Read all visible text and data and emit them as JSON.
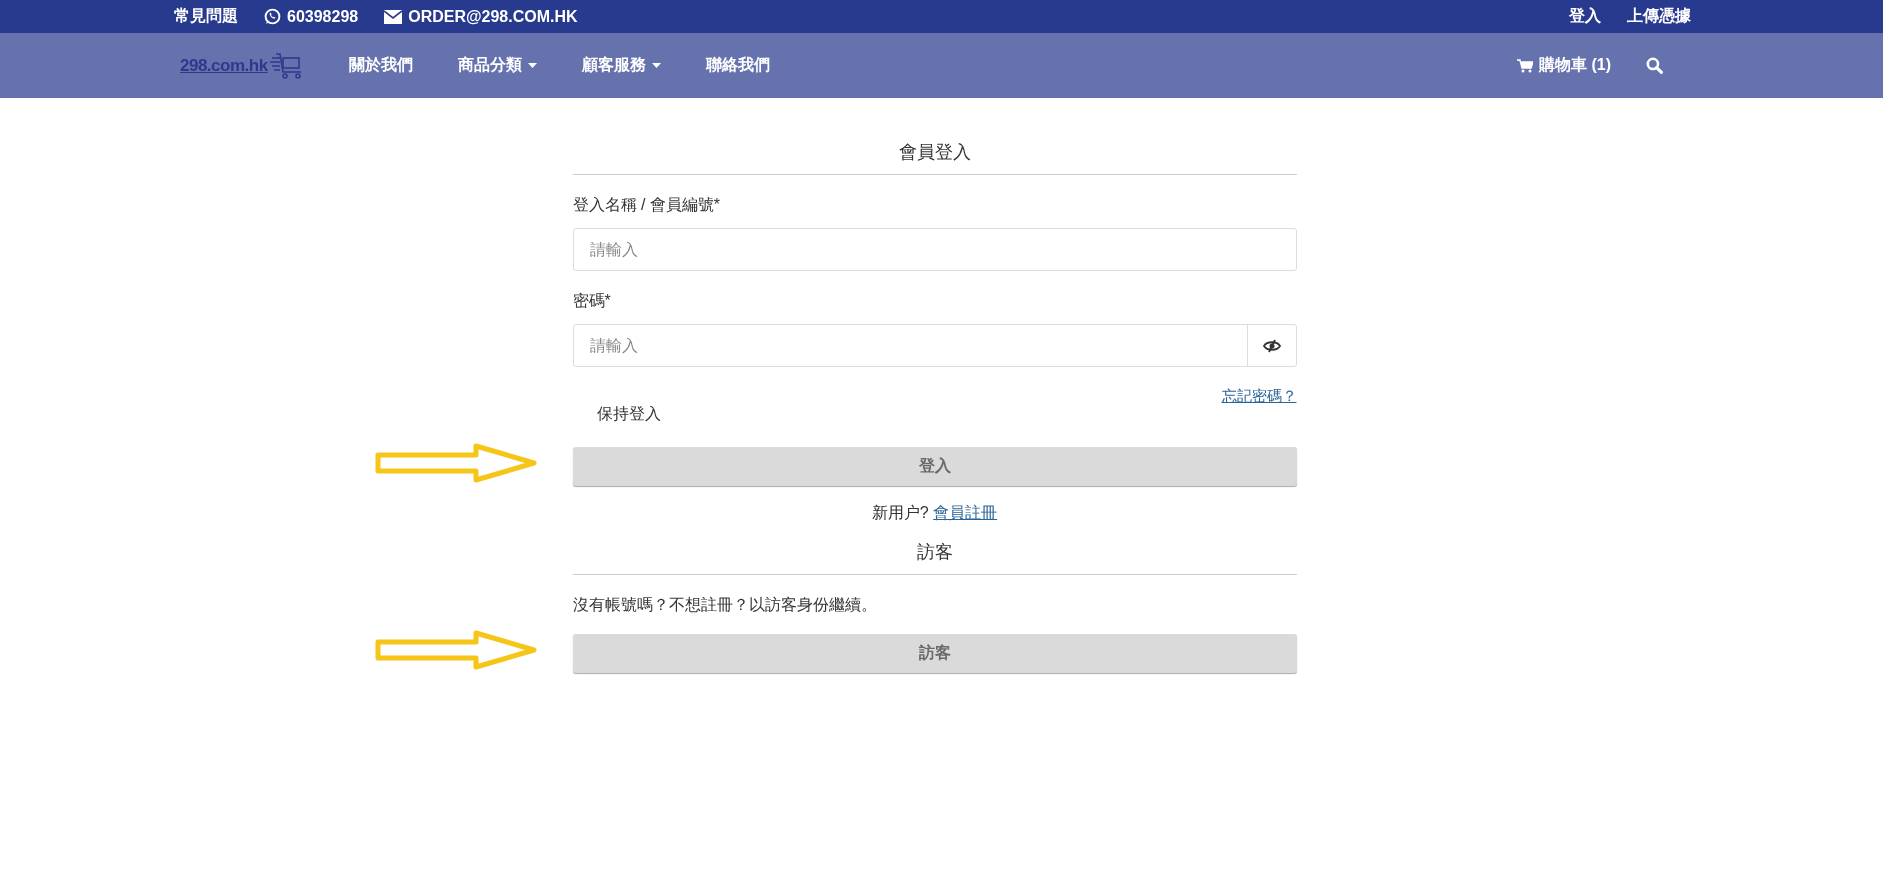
{
  "top_bar": {
    "faq": "常見問題",
    "phone": "60398298",
    "email": "ORDER@298.COM.HK",
    "links": [
      "登入",
      "上傳憑據"
    ]
  },
  "nav": {
    "logo": "298.com.hk",
    "items": [
      {
        "label": "關於我們",
        "dropdown": false
      },
      {
        "label": "商品分類",
        "dropdown": true
      },
      {
        "label": "顧客服務",
        "dropdown": true
      },
      {
        "label": "聯絡我們",
        "dropdown": false
      }
    ],
    "cart": "購物車 (1)"
  },
  "login": {
    "title": "會員登入",
    "fields": [
      {
        "label": "登入名稱 / 會員編號*",
        "placeholder": "請輸入",
        "kind": "text"
      },
      {
        "label": "密碼*",
        "placeholder": "請輸入",
        "kind": "password"
      }
    ],
    "forgot_link": "忘記密碼？",
    "remember": "保持登入",
    "button": {
      "label": "登入",
      "disabled": true
    },
    "register_prompt": "新用户?",
    "register_link": "會員註冊"
  },
  "guest": {
    "title": "訪客",
    "text": "沒有帳號嗎？不想註冊？以訪客身份繼續。",
    "button": {
      "label": "訪客",
      "disabled": true
    }
  }
}
